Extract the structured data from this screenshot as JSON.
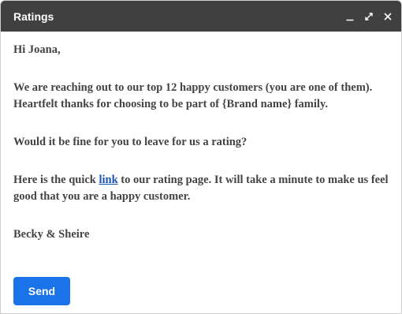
{
  "window": {
    "title": "Ratings",
    "controls": [
      {
        "name": "minimize-icon"
      },
      {
        "name": "expand-icon"
      },
      {
        "name": "close-icon"
      }
    ]
  },
  "message": {
    "greeting": "Hi Joana,",
    "para1_line1": "We are reaching out to our top 12 happy customers (you are one of them).",
    "para1_line2": "Heartfelt thanks for choosing to be part of {Brand name} family.",
    "para2": "Would it be fine for you to leave for us a rating?",
    "para3_before": "Here is the quick ",
    "para3_link": "link",
    "para3_after": " to our rating page. It will take a minute to make us feel good that you are a happy customer.",
    "signature": "Becky & Sheire"
  },
  "actions": {
    "send_label": "Send"
  },
  "colors": {
    "titlebar": "#404040",
    "send_button": "#1a73e8",
    "link": "#1a55b5",
    "text": "#444444"
  }
}
